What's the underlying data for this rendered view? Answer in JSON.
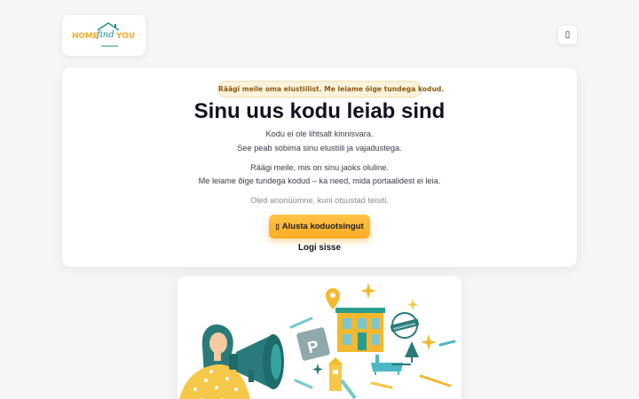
{
  "logo": {
    "home": "HOME",
    "find": "find",
    "you": "YOU"
  },
  "header": {
    "menu_icon": "menu-icon",
    "menu_glyph": "▯"
  },
  "hero": {
    "badge": "Räägi meile oma elustiilist. Me leiame õige tundega kodud.",
    "title": "Sinu uus kodu leiab sind",
    "line1": "Kodu ei ole lihtsalt kinnisvara.",
    "line2": "See peab sobima sinu elustiili ja vajadustega.",
    "line3": "Räägi meile, mis on sinu jaoks oluline.",
    "line4": "Me leiame õige tundega kodud – ka need, mida portaalidest ei leia.",
    "anonymous": "Oled anonüümne, kuni otsustad teisiti.",
    "cta": {
      "label": "Alusta koduotsingut",
      "icon": "chat-icon",
      "glyph": "▯"
    },
    "login": "Logi sisse"
  },
  "illustration": {
    "parking_letter": "P",
    "sign_text": "KODUSOOVIJA"
  },
  "colors": {
    "brand_yellow": "#f2ad2c",
    "brand_teal": "#1f8f8a",
    "cta_yellow": "#fbab25",
    "badge_bg": "#fdf3dc",
    "page_bg": "#f6f6f7"
  }
}
